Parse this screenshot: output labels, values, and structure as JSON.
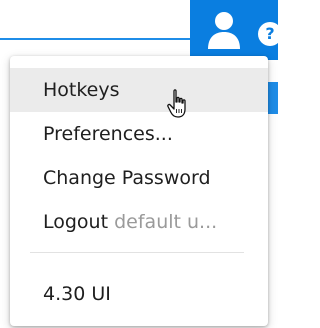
{
  "header": {
    "user_icon": "user-icon",
    "help_icon": "help-icon",
    "help_glyph": "?",
    "accent_color": "#0a7ee0"
  },
  "menu": {
    "items": [
      {
        "label": "Hotkeys"
      },
      {
        "label": "Preferences..."
      },
      {
        "label": "Change Password"
      },
      {
        "label": "Logout",
        "sublabel": "default u..."
      },
      {
        "label": "4.30 UI"
      }
    ],
    "hovered_item": "Hotkeys"
  },
  "cursor": {
    "icon": "hand-pointer-icon"
  }
}
